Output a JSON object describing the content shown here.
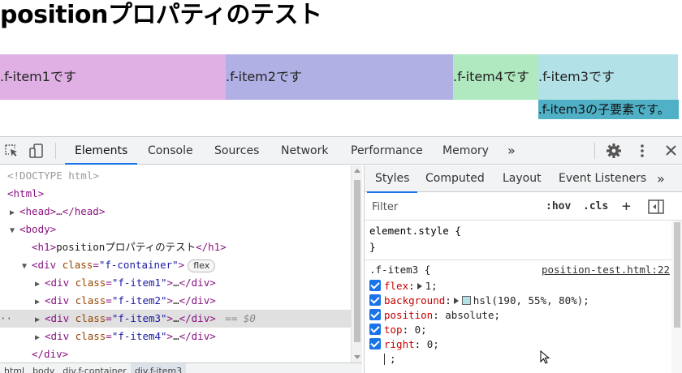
{
  "page": {
    "title": "positionプロパティのテスト",
    "items": {
      "item1": ".f-item1です",
      "item2": ".f-item2です",
      "item4": ".f-item4です",
      "item3": ".f-item3です",
      "child": ".f-item3の子要素です。"
    },
    "colors": {
      "item1": "#e0b0e4",
      "item2": "#b0b0e4",
      "item4": "#b0e8c0",
      "item3": "#b2e2e8",
      "child": "#4fb0c6"
    }
  },
  "devtools": {
    "tabs": [
      "Elements",
      "Console",
      "Sources",
      "Network",
      "Performance",
      "Memory"
    ],
    "more": "»",
    "icons": [
      "inspect-element-icon",
      "device-toggle-icon",
      "gear-icon",
      "kebab-menu-icon",
      "close-icon"
    ],
    "dom": {
      "doctype": "<!DOCTYPE html>",
      "html_open": "<html>",
      "head": "<head>…</head>",
      "body_open": "<body>",
      "h1_open": "<h1>",
      "h1_text": "positionプロパティのテスト",
      "h1_close": "</h1>",
      "div_open": "<div ",
      "class_attr": "class",
      "eq": "=",
      "container_class": "\"f-container\"",
      "gt": ">",
      "flex_badge": "flex",
      "item1_class": "\"f-item1\"",
      "item2_class": "\"f-item2\"",
      "item3_class": "\"f-item3\"",
      "item4_class": "\"f-item4\"",
      "ellipsis": "…",
      "div_close": "</div>",
      "selected_suffix": "== $0",
      "row_dots": "··"
    },
    "breadcrumbs": [
      "html",
      "body",
      "div.f-container",
      "div.f-item3"
    ],
    "styles": {
      "tabs": [
        "Styles",
        "Computed",
        "Layout",
        "Event Listeners"
      ],
      "more": "»",
      "filter_placeholder": "Filter",
      "hov": ":hov",
      "cls": ".cls",
      "plus": "+",
      "element_style": "element.style {",
      "close_brace": "}",
      "rule_selector": ".f-item3 {",
      "source": "position-test.html:22",
      "declarations": [
        {
          "name": "flex",
          "value": "1;",
          "expandable": true
        },
        {
          "name": "background",
          "value": "hsl(190, 55%, 80%);",
          "expandable": true,
          "swatch": "#b2e2e8"
        },
        {
          "name": "position",
          "value": "absolute;"
        },
        {
          "name": "top",
          "value": "0;"
        },
        {
          "name": "right",
          "value": "0;"
        }
      ],
      "new_decl": ";"
    }
  }
}
